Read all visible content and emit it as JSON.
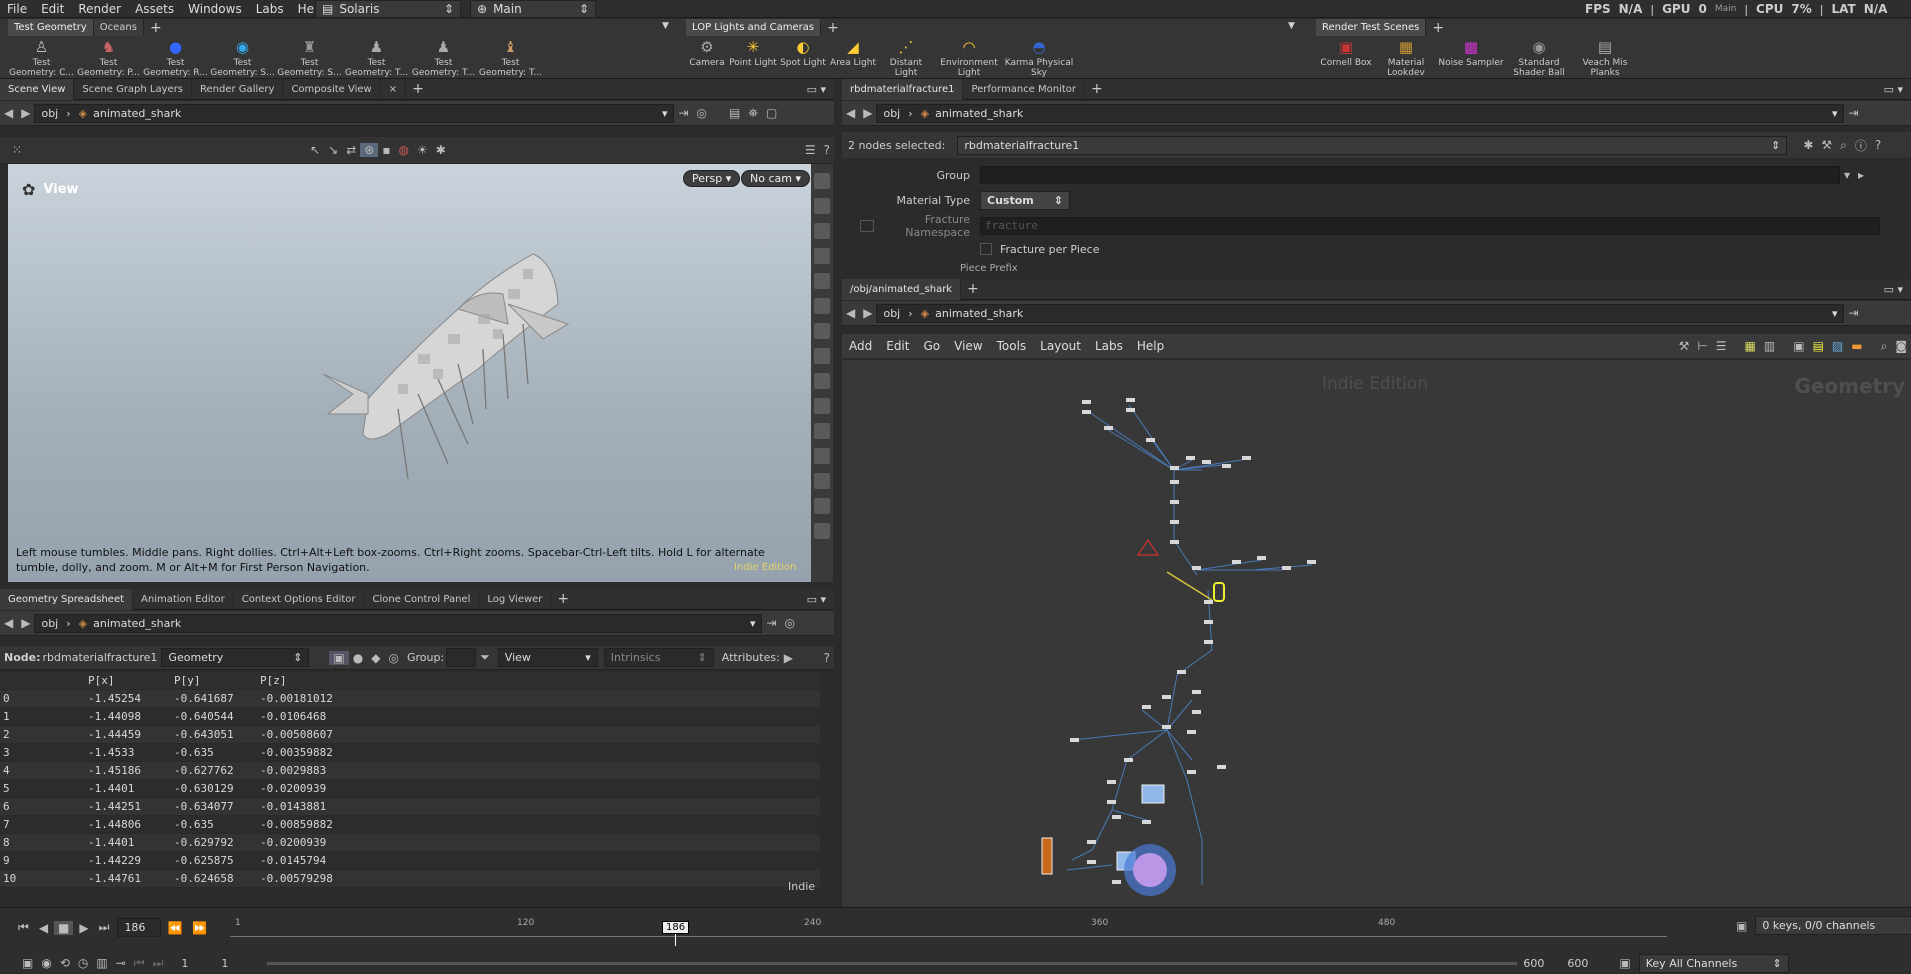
{
  "menu": [
    "File",
    "Edit",
    "Render",
    "Assets",
    "Windows",
    "Labs",
    "Help"
  ],
  "desktop": "Solaris",
  "context": "Main",
  "status": {
    "fps": "FPS",
    "fps_val": "N/A",
    "gpu": "GPU",
    "gpu_val": "0",
    "cpu": "CPU",
    "cpu_val": "7%",
    "lat": "LAT",
    "lat_val": "N/A",
    "main": "Main"
  },
  "shelf_left": {
    "tabs": [
      "Test Geometry",
      "Oceans"
    ],
    "tools": [
      "Test Geometry: C...",
      "Test Geometry: P...",
      "Test Geometry: R...",
      "Test Geometry: S...",
      "Test Geometry: S...",
      "Test Geometry: T...",
      "Test Geometry: T...",
      "Test Geometry: T..."
    ]
  },
  "shelf_mid": {
    "tabs": [
      "LOP Lights and Cameras"
    ],
    "tools": [
      "Camera",
      "Point Light",
      "Spot Light",
      "Area Light",
      "Distant Light",
      "Environment Light",
      "Karma Physical Sky"
    ]
  },
  "shelf_right": {
    "tabs": [
      "Render Test Scenes"
    ],
    "tools": [
      "Cornell Box",
      "Material Lookdev",
      "Noise Sampler",
      "Standard Shader Ball",
      "Veach Mis Planks"
    ]
  },
  "left_tabs": [
    "Scene View",
    "Scene Graph Layers",
    "Render Gallery",
    "Composite View"
  ],
  "path": {
    "root": "obj",
    "node": "animated_shark"
  },
  "viewport": {
    "title": "View",
    "persp": "Persp",
    "cam": "No cam",
    "hint": "Left mouse tumbles. Middle pans. Right dollies. Ctrl+Alt+Left box-zooms. Ctrl+Right zooms. Spacebar-Ctrl-Left tilts. Hold L for alternate tumble, dolly, and zoom. M or Alt+M for First Person Navigation.",
    "watermark": "Indie Edition"
  },
  "bottom_tabs": [
    "Geometry Spreadsheet",
    "Animation Editor",
    "Context Options Editor",
    "Clone Control Panel",
    "Log Viewer"
  ],
  "sheet": {
    "node_label": "Node:",
    "node": "rbdmaterialfracture1",
    "geo": "Geometry",
    "group_label": "Group:",
    "view": "View",
    "intrinsics": "Intrinsics",
    "attr_label": "Attributes:",
    "edition": "Indie",
    "headers": [
      "",
      "P[x]",
      "P[y]",
      "P[z]"
    ],
    "rows": [
      [
        "0",
        "-1.45254",
        "-0.641687",
        "-0.00181012"
      ],
      [
        "1",
        "-1.44098",
        "-0.640544",
        "-0.0106468"
      ],
      [
        "2",
        "-1.44459",
        "-0.643051",
        "-0.00508607"
      ],
      [
        "3",
        "-1.4533",
        "-0.635",
        "-0.00359882"
      ],
      [
        "4",
        "-1.45186",
        "-0.627762",
        "-0.0029883"
      ],
      [
        "5",
        "-1.4401",
        "-0.630129",
        "-0.0200939"
      ],
      [
        "6",
        "-1.44251",
        "-0.634077",
        "-0.0143881"
      ],
      [
        "7",
        "-1.44806",
        "-0.635",
        "-0.00859882"
      ],
      [
        "8",
        "-1.4401",
        "-0.629792",
        "-0.0200939"
      ],
      [
        "9",
        "-1.44229",
        "-0.625875",
        "-0.0145794"
      ],
      [
        "10",
        "-1.44761",
        "-0.624658",
        "-0.00579298"
      ]
    ]
  },
  "right_tabs": [
    "rbdmaterialfracture1",
    "Performance Monitor"
  ],
  "params": {
    "selected": "2 nodes selected:",
    "node": "rbdmaterialfracture1",
    "group": "Group",
    "mattype": "Material Type",
    "mattype_val": "Custom",
    "ns": "Fracture Namespace",
    "ns_val": "fracture",
    "fpp": "Fracture per Piece",
    "prefix": "Piece Prefix"
  },
  "net_tabs": [
    "/obj/animated_shark"
  ],
  "net": {
    "menu": [
      "Add",
      "Edit",
      "Go",
      "View",
      "Tools",
      "Layout",
      "Labs",
      "Help"
    ],
    "edition": "Indie Edition",
    "context": "Geometry"
  },
  "timeline": {
    "frame": "186",
    "start": "1",
    "end": "1",
    "range_end": "600",
    "range_end2": "600",
    "ticks": [
      "1",
      "120",
      "240",
      "360",
      "480"
    ],
    "keys": "0 keys, 0/0 channels",
    "keyall": "Key All Channels"
  }
}
